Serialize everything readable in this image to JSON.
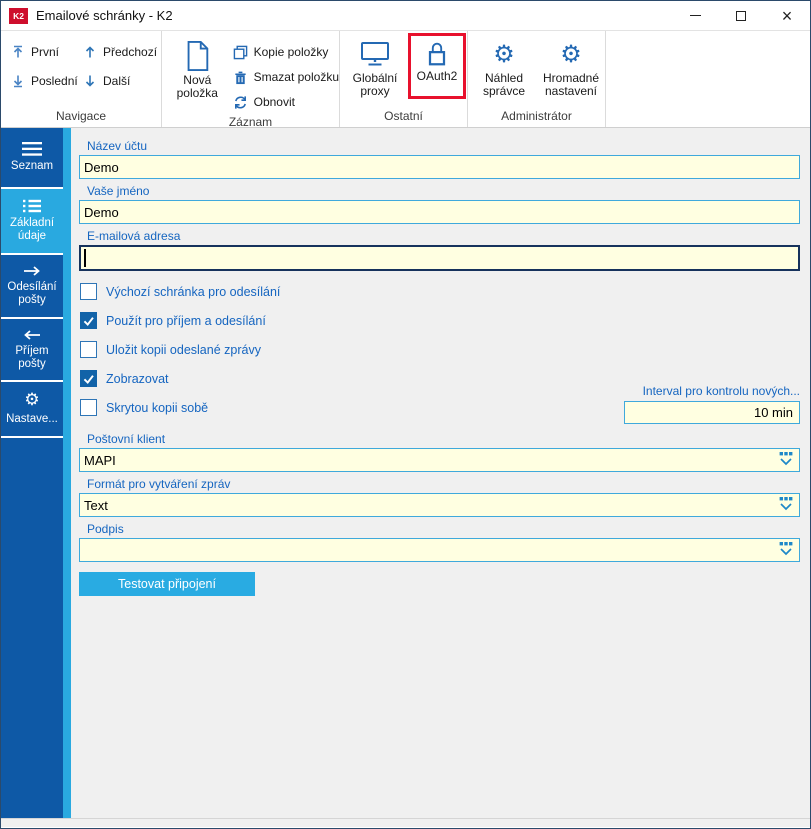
{
  "window": {
    "title": "Emailové schránky - K2",
    "logo_text": "K2",
    "controls": {
      "minimize": "minimize",
      "maximize": "maximize",
      "close_glyph": "×"
    }
  },
  "ribbon": {
    "groups": [
      {
        "label": "Navigace",
        "buttons": [
          {
            "label": "První",
            "icon": "arrow-up-to-bar"
          },
          {
            "label": "Poslední",
            "icon": "arrow-down-to-bar"
          },
          {
            "label": "Předchozí",
            "icon": "arrow-up"
          },
          {
            "label": "Další",
            "icon": "arrow-down"
          }
        ]
      },
      {
        "label": "Záznam",
        "big": {
          "label": "Nová položka",
          "icon": "new-document"
        },
        "buttons": [
          {
            "label": "Kopie položky",
            "icon": "copy"
          },
          {
            "label": "Smazat položku",
            "icon": "trash"
          },
          {
            "label": "Obnovit",
            "icon": "refresh"
          }
        ]
      },
      {
        "label": "Ostatní",
        "buttons": [
          {
            "label": "Globální proxy",
            "icon": "monitor"
          },
          {
            "label": "OAuth2",
            "icon": "lock",
            "highlighted": true
          }
        ]
      },
      {
        "label": "Administrátor",
        "buttons": [
          {
            "label": "Náhled správce",
            "icon": "gear"
          },
          {
            "label": "Hromadné nastavení",
            "icon": "gear"
          }
        ]
      }
    ],
    "gear_glyph": "⚙"
  },
  "sidebar": {
    "items": [
      {
        "label": "Seznam",
        "icon": "hamburger-menu",
        "active": false
      },
      {
        "label": "Základní údaje",
        "icon": "list",
        "active": true
      },
      {
        "label": "Odesílání pošty",
        "icon": "arrow-right",
        "active": false
      },
      {
        "label": "Příjem pošty",
        "icon": "arrow-left",
        "active": false
      },
      {
        "label": "Nastave...",
        "icon": "gear",
        "active": false
      }
    ]
  },
  "form": {
    "text_fields": [
      {
        "label": "Název účtu",
        "value": "Demo",
        "focused": false
      },
      {
        "label": "Vaše jméno",
        "value": "Demo",
        "focused": false
      },
      {
        "label": "E-mailová adresa",
        "value": "",
        "focused": true
      }
    ],
    "checkboxes": [
      {
        "label": "Výchozí schránka pro odesílání",
        "checked": false
      },
      {
        "label": "Použít pro příjem a odesílání",
        "checked": true
      },
      {
        "label": "Uložit kopii odeslané zprávy",
        "checked": false
      },
      {
        "label": "Zobrazovat",
        "checked": true
      },
      {
        "label": "Skrytou kopii sobě",
        "checked": false
      }
    ],
    "interval": {
      "label": "Interval pro kontrolu nových...",
      "value": "10 min"
    },
    "dropdowns": [
      {
        "label": "Poštovní klient",
        "value": "MAPI"
      },
      {
        "label": "Formát pro vytváření zpráv",
        "value": "Text"
      },
      {
        "label": "Podpis",
        "value": ""
      }
    ],
    "test_button_label": "Testovat připojení"
  },
  "colors": {
    "accent_cyan": "#29A9E0",
    "sidebar_blue": "#0E59A6",
    "label_blue": "#1565C0",
    "checked_blue": "#1263A8",
    "input_bg": "#FFFFE1",
    "input_border": "#3FA9DC",
    "highlight_red": "#E8112D",
    "ribbon_icon_blue": "#2469B3"
  }
}
